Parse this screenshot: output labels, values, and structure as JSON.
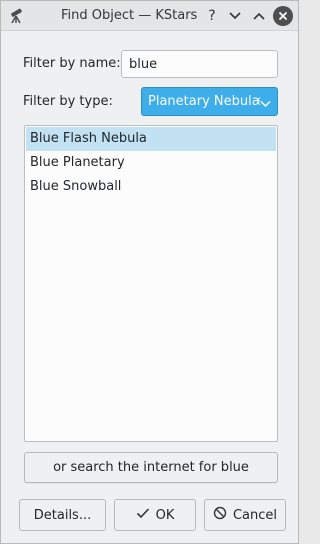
{
  "window": {
    "title": "Find Object — KStars",
    "help_glyph": "?"
  },
  "filter": {
    "name_label": "Filter by name:",
    "name_value": "blue",
    "type_label": "Filter by type:",
    "type_selected": "Planetary Nebulæ"
  },
  "results": {
    "items": [
      {
        "label": "Blue Flash Nebula",
        "selected": true
      },
      {
        "label": "Blue Planetary",
        "selected": false
      },
      {
        "label": "Blue Snowball",
        "selected": false
      }
    ]
  },
  "search_internet_label": "or search the internet for blue",
  "buttons": {
    "details": "Details...",
    "ok": "OK",
    "cancel": "Cancel"
  },
  "colors": {
    "accent": "#3daee9",
    "selection": "#c2e1f2",
    "window_bg": "#eff0f1"
  },
  "icons": {
    "app": "telescope-icon",
    "help": "help-icon",
    "minimize": "chevron-down-icon",
    "maximize": "chevron-up-icon",
    "close": "close-icon",
    "ok": "checkmark-icon",
    "cancel": "cancel-icon"
  }
}
